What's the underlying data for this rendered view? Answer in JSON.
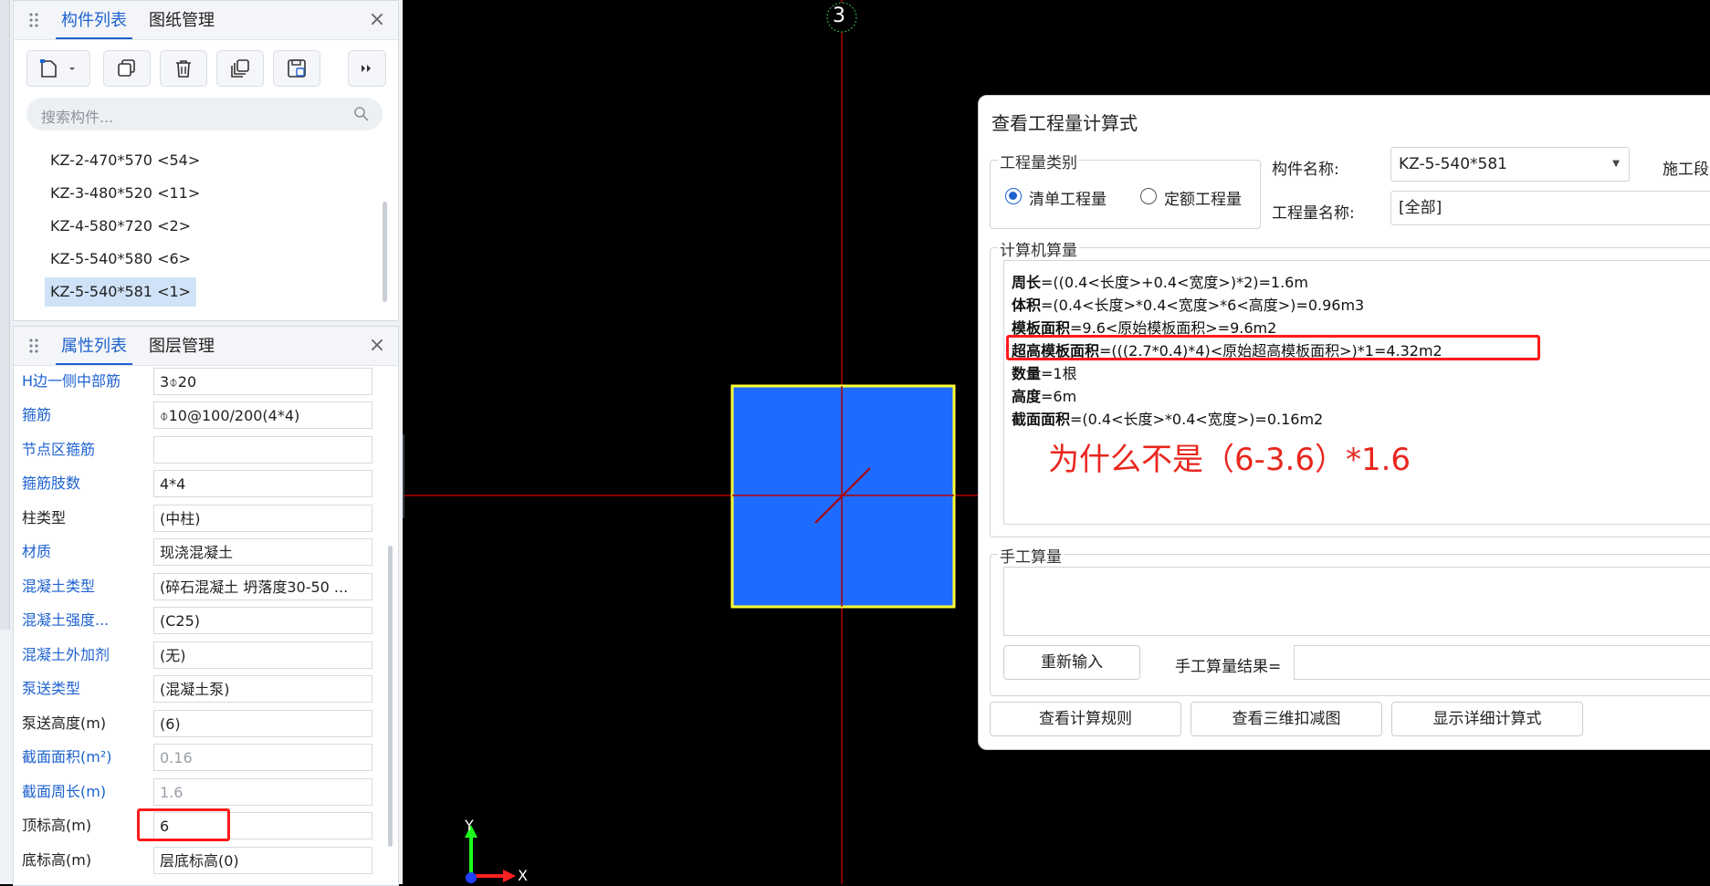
{
  "component_panel": {
    "tabs": [
      "构件列表",
      "图纸管理"
    ],
    "close_icon": "×",
    "search_placeholder": "搜索构件...",
    "items": [
      "KZ-2-470*570 <54>",
      "KZ-3-480*520 <11>",
      "KZ-4-580*720 <2>",
      "KZ-5-540*580 <6>",
      "KZ-5-540*581 <1>"
    ],
    "selected_index": 4
  },
  "property_panel": {
    "tabs": [
      "属性列表",
      "图层管理"
    ],
    "close_icon": "×",
    "rows": [
      {
        "label": "H边一侧中部筋",
        "value": "3⌽20",
        "label_color": "blue",
        "value_style": "normal"
      },
      {
        "label": "箍筋",
        "value": "⌽10@100/200(4*4)",
        "label_color": "blue",
        "value_style": "normal"
      },
      {
        "label": "节点区箍筋",
        "value": "",
        "label_color": "blue",
        "value_style": "normal"
      },
      {
        "label": "箍筋肢数",
        "value": "4*4",
        "label_color": "blue",
        "value_style": "normal"
      },
      {
        "label": "柱类型",
        "value": "(中柱)",
        "label_color": "black",
        "value_style": "normal"
      },
      {
        "label": "材质",
        "value": "现浇混凝土",
        "label_color": "blue",
        "value_style": "normal"
      },
      {
        "label": "混凝土类型",
        "value": "(碎石混凝土 坍落度30-50 ...",
        "label_color": "blue",
        "value_style": "normal"
      },
      {
        "label": "混凝土强度...",
        "value": "(C25)",
        "label_color": "blue",
        "value_style": "normal"
      },
      {
        "label": "混凝土外加剂",
        "value": "(无)",
        "label_color": "blue",
        "value_style": "normal"
      },
      {
        "label": "泵送类型",
        "value": "(混凝土泵)",
        "label_color": "blue",
        "value_style": "normal"
      },
      {
        "label": "泵送高度(m)",
        "value": "(6)",
        "label_color": "black",
        "value_style": "normal"
      },
      {
        "label": "截面面积(m²)",
        "value": "0.16",
        "label_color": "blue",
        "value_style": "gray"
      },
      {
        "label": "截面周长(m)",
        "value": "1.6",
        "label_color": "blue",
        "value_style": "gray"
      },
      {
        "label": "顶标高(m)",
        "value": "6",
        "label_color": "black",
        "value_style": "normal"
      },
      {
        "label": "底标高(m)",
        "value": "层底标高(0)",
        "label_color": "black",
        "value_style": "normal"
      }
    ]
  },
  "canvas": {
    "axis_label": "3",
    "y_axis": "Y",
    "x_axis": "X",
    "column_fill": "#1f6bff",
    "column_border": "#ffff33",
    "gridline_color": "#b10000"
  },
  "dialog": {
    "title": "查看工程量计算式",
    "quantity_type_group": "工程量类别",
    "radio_bill": "清单工程量",
    "radio_quota": "定额工程量",
    "component_name_label": "构件名称:",
    "component_name_value": "KZ-5-540*581",
    "construction_section_label": "施工段",
    "quantity_name_label": "工程量名称:",
    "quantity_name_value": "[全部]",
    "computer_group": "计算机算量",
    "calc_lines": [
      {
        "name": "周长",
        "formula": "=((0.4<长度>+0.4<宽度>)*2)=1.6m"
      },
      {
        "name": "体积",
        "formula": "=(0.4<长度>*0.4<宽度>*6<高度>)=0.96m3"
      },
      {
        "name": "模板面积",
        "formula": "=9.6<原始模板面积>=9.6m2"
      },
      {
        "name": "超高模板面积",
        "formula": "=(((2.7*0.4)*4)<原始超高模板面积>)*1=4.32m2"
      },
      {
        "name": "数量",
        "formula": "=1根"
      },
      {
        "name": "高度",
        "formula": "=6m"
      },
      {
        "name": "截面面积",
        "formula": "=(0.4<长度>*0.4<宽度>)=0.16m2"
      }
    ],
    "annotation": "为什么不是（6-3.6）*1.6",
    "manual_group": "手工算量",
    "reinput_button": "重新输入",
    "manual_result_label": "手工算量结果=",
    "view_rules_button": "查看计算规则",
    "view_3d_button": "查看三维扣减图",
    "show_detail_button": "显示详细计算式"
  }
}
